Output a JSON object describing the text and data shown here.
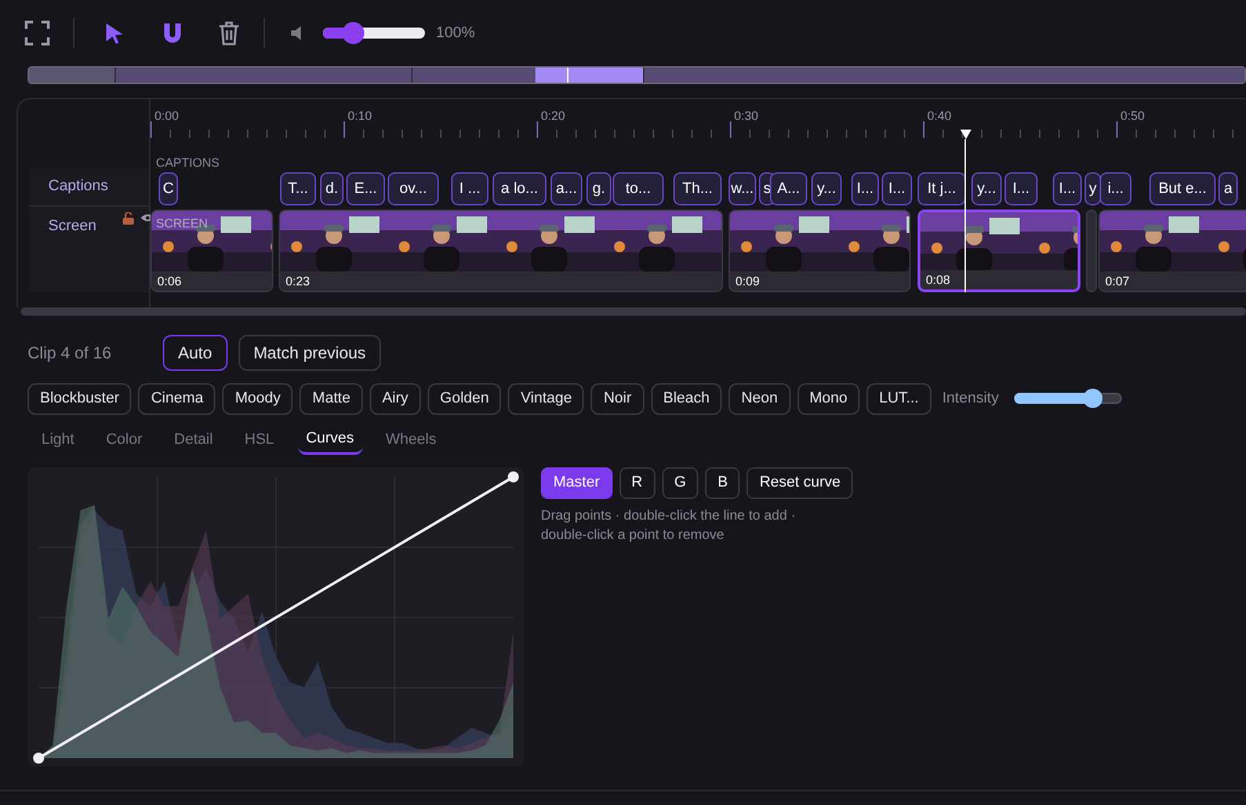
{
  "toolbar": {
    "pointer_active": true,
    "snap_on": true,
    "volume": {
      "level": 0.3,
      "reading": "100%"
    }
  },
  "timeline": {
    "ruler": [
      "0:00",
      "0:10",
      "0:20",
      "0:30",
      "0:40",
      "0:50"
    ],
    "tracks": [
      {
        "label": "Captions",
        "tag": "CAPTIONS"
      },
      {
        "label": "Screen",
        "tag": "SCREEN"
      }
    ],
    "captions": [
      {
        "text": "C"
      },
      {
        "text": "T..."
      },
      {
        "text": "d."
      },
      {
        "text": "E..."
      },
      {
        "text": "ov..."
      },
      {
        "text": "I ..."
      },
      {
        "text": "a lo..."
      },
      {
        "text": "a..."
      },
      {
        "text": "g."
      },
      {
        "text": "to..."
      },
      {
        "text": "Th..."
      },
      {
        "text": "w..."
      },
      {
        "text": "s"
      },
      {
        "text": "A..."
      },
      {
        "text": "y..."
      },
      {
        "text": "I..."
      },
      {
        "text": "I..."
      },
      {
        "text": "It j..."
      },
      {
        "text": "y..."
      },
      {
        "text": "I..."
      },
      {
        "text": "I..."
      },
      {
        "text": "y"
      },
      {
        "text": "i..."
      },
      {
        "text": "But e..."
      },
      {
        "text": "a"
      }
    ],
    "clips": [
      {
        "duration": "0:06",
        "selected": false
      },
      {
        "duration": "0:23",
        "selected": false
      },
      {
        "duration": "0:09",
        "selected": false
      },
      {
        "duration": "0:08",
        "selected": true
      },
      {
        "selected": false
      },
      {
        "duration": "0:07",
        "selected": false
      }
    ]
  },
  "grade": {
    "clip_label": "Clip 4 of 16",
    "modes": [
      {
        "label": "Auto",
        "selected": true
      },
      {
        "label": "Match previous",
        "selected": false
      }
    ],
    "presets": [
      "Blockbuster",
      "Cinema",
      "Moody",
      "Matte",
      "Airy",
      "Golden",
      "Vintage",
      "Noir",
      "Bleach",
      "Neon",
      "Mono",
      "LUT..."
    ],
    "intensity": {
      "label": "Intensity",
      "level": 0.73
    },
    "tabs": [
      {
        "label": "Light",
        "selected": false
      },
      {
        "label": "Color",
        "selected": false
      },
      {
        "label": "Detail",
        "selected": false
      },
      {
        "label": "HSL",
        "selected": false
      },
      {
        "label": "Curves",
        "selected": true
      },
      {
        "label": "Wheels",
        "selected": false
      }
    ],
    "curves": {
      "channels": [
        {
          "label": "Master",
          "selected": true
        },
        {
          "label": "R",
          "selected": false
        },
        {
          "label": "G",
          "selected": false
        },
        {
          "label": "B",
          "selected": false
        }
      ],
      "reset": "Reset curve",
      "hint": "Drag points · double-click the line to add · double-click a point to remove"
    }
  }
}
